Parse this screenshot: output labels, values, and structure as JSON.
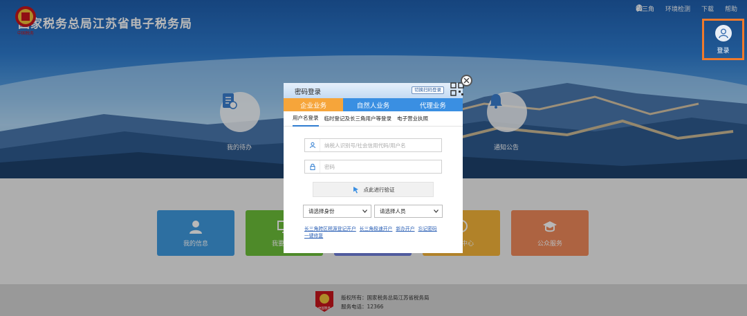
{
  "header": {
    "site_title": "国家税务总局江苏省电子税务局",
    "emblem_text": "中国税务",
    "nav": [
      {
        "icon": "triangle-nodes-icon",
        "label": "长三角"
      },
      {
        "icon": "wrench-icon",
        "label": "环境检测"
      },
      {
        "icon": "download-icon",
        "label": "下载"
      },
      {
        "icon": "help-icon",
        "label": "帮助"
      }
    ],
    "login_label": "登录"
  },
  "hero": {
    "left_label": "我的待办",
    "right_label": "通知公告"
  },
  "tiles": [
    {
      "label": "我的信息",
      "color": "#3f9ae0",
      "icon": "person-icon"
    },
    {
      "label": "我要办税",
      "color": "#6cbf3a",
      "icon": "monitor-icon"
    },
    {
      "label": "",
      "color": "#6f7fdc",
      "icon": "blank"
    },
    {
      "label": "互动中心",
      "color": "#f5b53a",
      "icon": "chat-icon"
    },
    {
      "label": "公众服务",
      "color": "#f08a5a",
      "icon": "graduate-icon"
    }
  ],
  "modal": {
    "title": "密码登录",
    "switch_label": "切换扫码登录",
    "biz_tabs": [
      "企业业务",
      "自然人业务",
      "代理业务"
    ],
    "sub_tabs": [
      "用户名登录",
      "临时登记及长三角用户等登录",
      "电子营业执照"
    ],
    "username_placeholder": "纳税人识别号/社会信用代码/用户名",
    "password_placeholder": "密码",
    "verify_label": "点此进行验证",
    "identity_select": "请选择身份",
    "person_select": "请选择人员",
    "links": [
      "长三角跨区税源登记开户",
      "长三角极速开户",
      "新办开户",
      "忘记密码",
      "一键修复"
    ]
  },
  "footer": {
    "copyright": "版权所有：国家税务总局江苏省税务局",
    "phone": "服务电话：12366",
    "logo_text": "中国税务"
  },
  "colors": {
    "highlight": "#f07a2b",
    "tab_active": "#f6a53a",
    "tab_inactive": "#3a8fe2"
  }
}
